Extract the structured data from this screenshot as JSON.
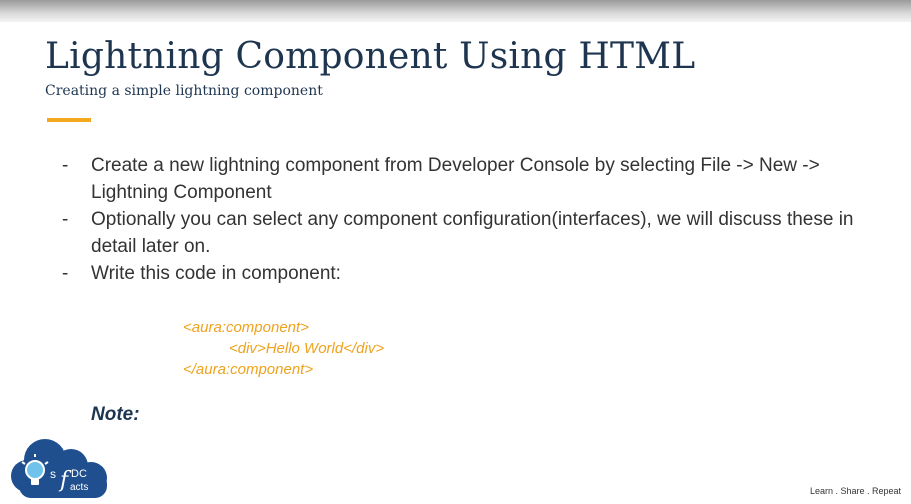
{
  "slide": {
    "title": "Lightning Component Using HTML",
    "subtitle": "Creating a simple lightning component",
    "bullets": [
      {
        "dash": "-",
        "text": "Create a new lightning component from Developer Console by selecting File -> New -> Lightning Component"
      },
      {
        "dash": "-",
        "text": "Optionally you can select any component configuration(interfaces), we will discuss these in detail later on."
      },
      {
        "dash": "-",
        "text": "Write this code in component:"
      }
    ],
    "code": [
      "<aura:component>",
      "<div>Hello World</div>",
      "</aura:component>"
    ],
    "note": "Note:",
    "footer": "Learn . Share . Repeat",
    "logo_text": {
      "s": "s",
      "f": "f",
      "dc": "DC",
      "acts": "acts"
    }
  },
  "colors": {
    "title": "#1e3550",
    "accent": "#f3a81d",
    "code": "#efa21e",
    "logo_cloud": "#1f4f8f",
    "logo_bulb": "#6fc3ea"
  },
  "icons": [
    "bulb-icon",
    "cloud-logo"
  ]
}
